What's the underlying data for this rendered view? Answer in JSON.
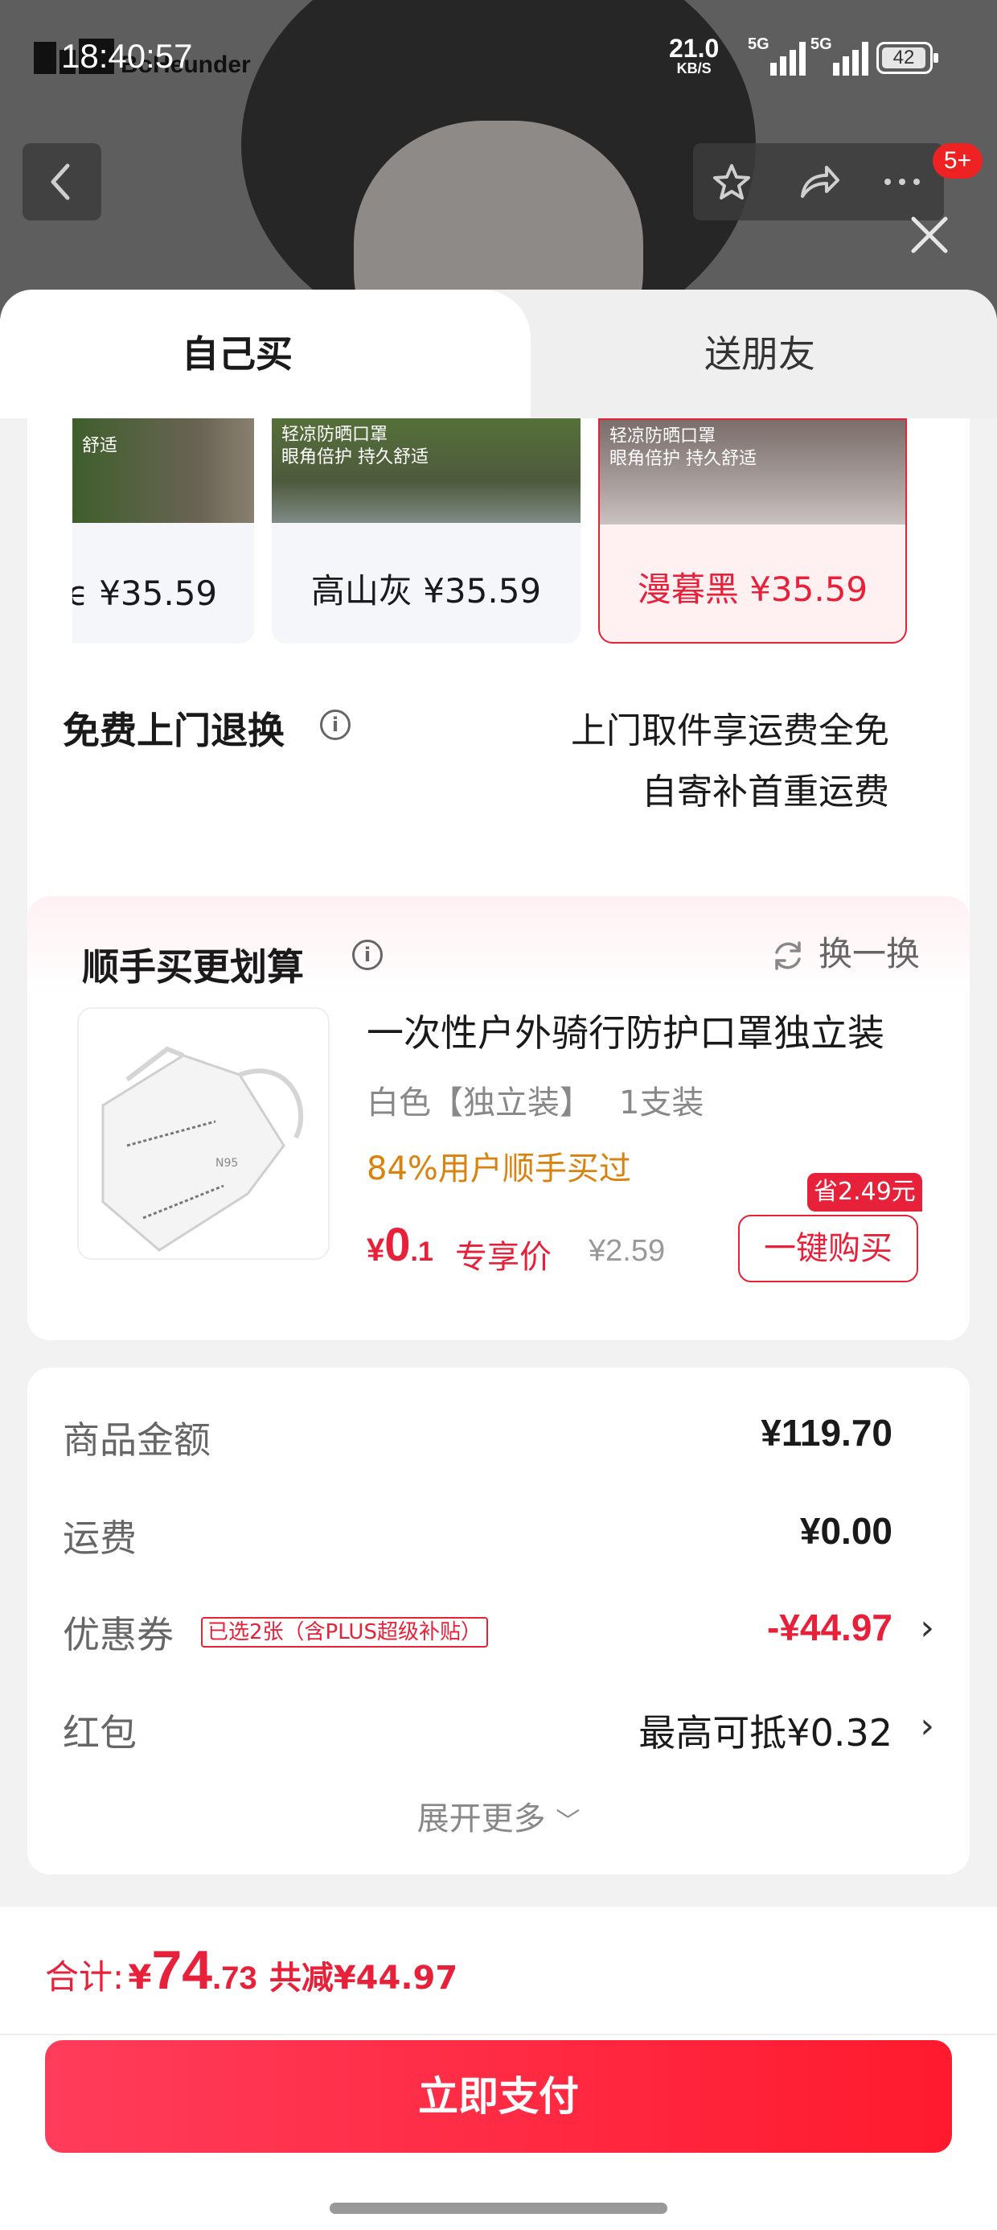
{
  "status_bar": {
    "time": "18:40:57",
    "brand": "BoHeunder",
    "speed_value": "21.0",
    "speed_unit": "KB/S",
    "network1": "5G",
    "network2": "5G",
    "battery": "42"
  },
  "nav": {
    "cart_badge": "5+",
    "icons": [
      "back-arrow-icon",
      "star-icon",
      "share-icon",
      "more-icon",
      "close-icon"
    ]
  },
  "tabs": {
    "self": "自己买",
    "friend": "送朋友"
  },
  "variants": [
    {
      "label": "ϵ ¥35.59",
      "caption1": "",
      "caption2": "舒适",
      "selected": false
    },
    {
      "label": "高山灰 ¥35.59",
      "caption1": "轻凉防晒口罩",
      "caption2": "眼角倍护 持久舒适",
      "selected": false
    },
    {
      "label": "漫暮黑 ¥35.59",
      "caption1": "轻凉防晒口罩",
      "caption2": "眼角倍护 持久舒适",
      "selected": true
    }
  ],
  "returns": {
    "label": "免费上门退换",
    "line1": "上门取件享运费全免",
    "line2": "自寄补首重运费"
  },
  "addon": {
    "title": "顺手买更划算",
    "swap": "换一换",
    "name": "一次性户外骑行防护口罩独立装",
    "spec": "白色【独立装】",
    "qty": "1支装",
    "stat": "84%用户顺手买过",
    "price_currency": "¥",
    "price_int": "0",
    "price_dec": ".1",
    "price_tag": "专享价",
    "original_price": "¥2.59",
    "save_tag": "省2.49元",
    "buy_label": "一键购买"
  },
  "summary": {
    "goods_label": "商品金额",
    "goods_value": "¥119.70",
    "shipping_label": "运费",
    "shipping_value": "¥0.00",
    "coupon_label": "优惠券",
    "coupon_tag": "已选2张（含PLUS超级补贴）",
    "coupon_value": "-¥44.97",
    "redpacket_label": "红包",
    "redpacket_value": "最高可抵¥0.32",
    "expand": "展开更多"
  },
  "total": {
    "label": "合计:",
    "currency": "¥",
    "int": "74",
    "dec": ".73",
    "reduction": "共减¥44.97"
  },
  "pay_button": "立即支付",
  "colors": {
    "accent": "#e8213a",
    "accent_orange": "#d9820e",
    "pay_gradient_start": "#ff3c5a",
    "pay_gradient_end": "#ff1a2e"
  }
}
